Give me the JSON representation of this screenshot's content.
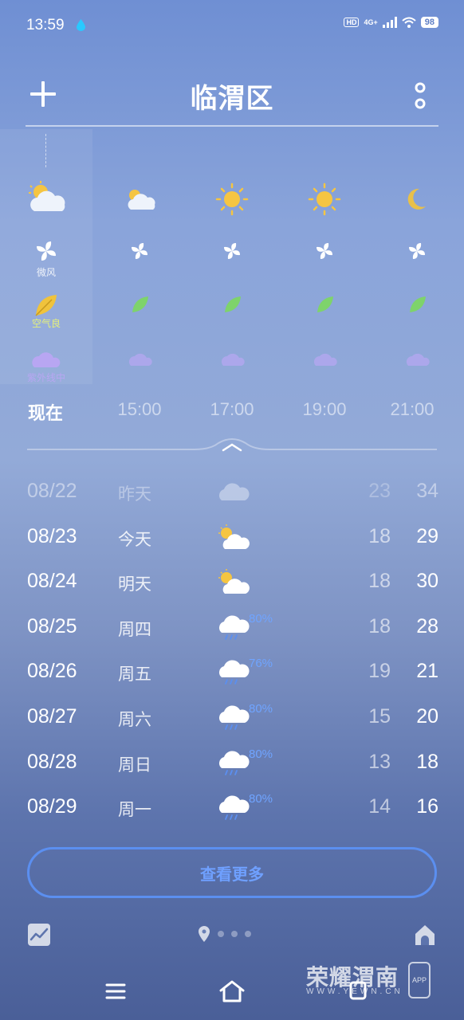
{
  "status": {
    "time": "13:59",
    "hd": "HD",
    "net": "4G+",
    "battery": "98"
  },
  "header": {
    "city": "临渭区"
  },
  "hourly": [
    {
      "time": "现在",
      "icon": "partly-cloudy-icon",
      "wind_label": "微风",
      "aq_label": "空气良",
      "uv_label": "紫外线中"
    },
    {
      "time": "15:00",
      "icon": "partly-cloudy-icon"
    },
    {
      "time": "17:00",
      "icon": "sun-icon"
    },
    {
      "time": "19:00",
      "icon": "sun-icon"
    },
    {
      "time": "21:00",
      "icon": "moon-icon"
    }
  ],
  "daily": [
    {
      "date": "08/22",
      "name": "昨天",
      "icon": "cloud-icon",
      "pct": "",
      "low": "23",
      "high": "34"
    },
    {
      "date": "08/23",
      "name": "今天",
      "icon": "partly-cloudy-icon",
      "pct": "",
      "low": "18",
      "high": "29"
    },
    {
      "date": "08/24",
      "name": "明天",
      "icon": "partly-cloudy-icon",
      "pct": "",
      "low": "18",
      "high": "30"
    },
    {
      "date": "08/25",
      "name": "周四",
      "icon": "rain-icon",
      "pct": "80%",
      "low": "18",
      "high": "28"
    },
    {
      "date": "08/26",
      "name": "周五",
      "icon": "rain-icon",
      "pct": "76%",
      "low": "19",
      "high": "21"
    },
    {
      "date": "08/27",
      "name": "周六",
      "icon": "rain-icon",
      "pct": "80%",
      "low": "15",
      "high": "20"
    },
    {
      "date": "08/28",
      "name": "周日",
      "icon": "rain-icon",
      "pct": "80%",
      "low": "13",
      "high": "18"
    },
    {
      "date": "08/29",
      "name": "周一",
      "icon": "rain-icon",
      "pct": "80%",
      "low": "14",
      "high": "16"
    }
  ],
  "more_button": "查看更多",
  "watermark": {
    "title": "荣耀渭南",
    "url": "WWW.YEWN.CN",
    "app": "APP"
  },
  "colors": {
    "accent": "#5b8ff0",
    "leaf": "#7ed36b",
    "uv": "#b8a6f2",
    "aq": "#e5f07a"
  }
}
